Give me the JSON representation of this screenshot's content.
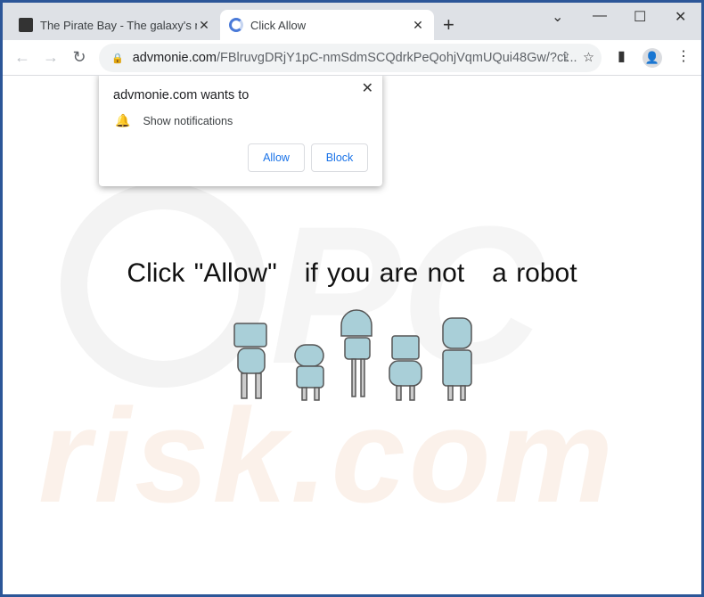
{
  "tabs": [
    {
      "title": "The Pirate Bay - The galaxy's most",
      "icon": "pirate-ship-icon",
      "active": false
    },
    {
      "title": "Click Allow",
      "icon": "loading-spinner-icon",
      "active": true
    }
  ],
  "address": {
    "domain": "advmonie.com",
    "path": "/FBlruvgDRjY1pC-nmSdmSCQdrkPeQohjVqmUQui48Gw/?ci..."
  },
  "popup": {
    "title": "advmonie.com wants to",
    "permission": "Show notifications",
    "allow": "Allow",
    "block": "Block"
  },
  "page": {
    "headline": "Click \"Allow\"   if you are not   a robot"
  },
  "watermark": "risk.com",
  "colors": {
    "frame": "#2c5698",
    "accent": "#1a73e8",
    "robot": "#a9cfd8"
  }
}
